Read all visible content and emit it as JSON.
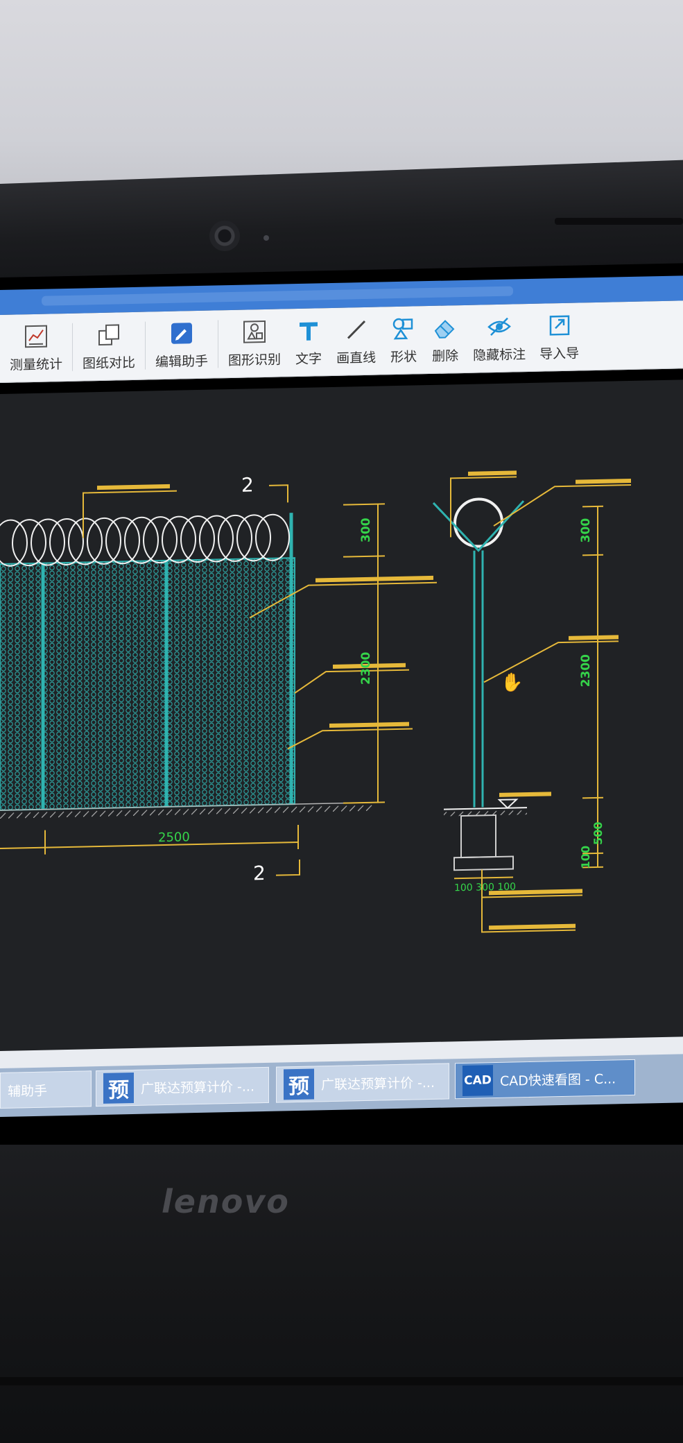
{
  "toolbar": {
    "items": [
      {
        "label": "测量统计",
        "icon": "measure-stats-icon"
      },
      {
        "label": "图纸对比",
        "icon": "compare-drawings-icon"
      },
      {
        "label": "编辑助手",
        "icon": "edit-assistant-icon"
      },
      {
        "label": "图形识别",
        "icon": "shape-recognition-icon"
      },
      {
        "label": "文字",
        "icon": "text-tool-icon"
      },
      {
        "label": "画直线",
        "icon": "draw-line-icon"
      },
      {
        "label": "形状",
        "icon": "shape-tool-icon"
      },
      {
        "label": "删除",
        "icon": "eraser-icon"
      },
      {
        "label": "隐藏标注",
        "icon": "hide-annotation-icon"
      },
      {
        "label": "导入导",
        "icon": "import-icon"
      }
    ]
  },
  "drawing": {
    "section_marker_top": "2",
    "section_marker_bottom": "2",
    "front_width": "2500",
    "front_top_height": "300",
    "front_mesh_height": "2300",
    "side_top_height": "300",
    "side_mesh_height": "2300",
    "side_foundation_100": "100",
    "side_foundation_500": "500",
    "footing_dims": "100 300 100"
  },
  "taskbar": {
    "items": [
      {
        "label": "辅助手"
      },
      {
        "label": "广联达预算计价 -..."
      },
      {
        "label": "广联达预算计价 -..."
      },
      {
        "label": "CAD快速看图 - C..."
      }
    ],
    "icon_glyph": "预",
    "cad_glyph": "CAD"
  },
  "laptop": {
    "brand": "lenovo"
  },
  "colors": {
    "canvas_bg": "#202225",
    "mesh": "#2fb3b0",
    "dim_yellow": "#e6b93a",
    "dim_green": "#35d44a",
    "wire": "#ffffff"
  }
}
